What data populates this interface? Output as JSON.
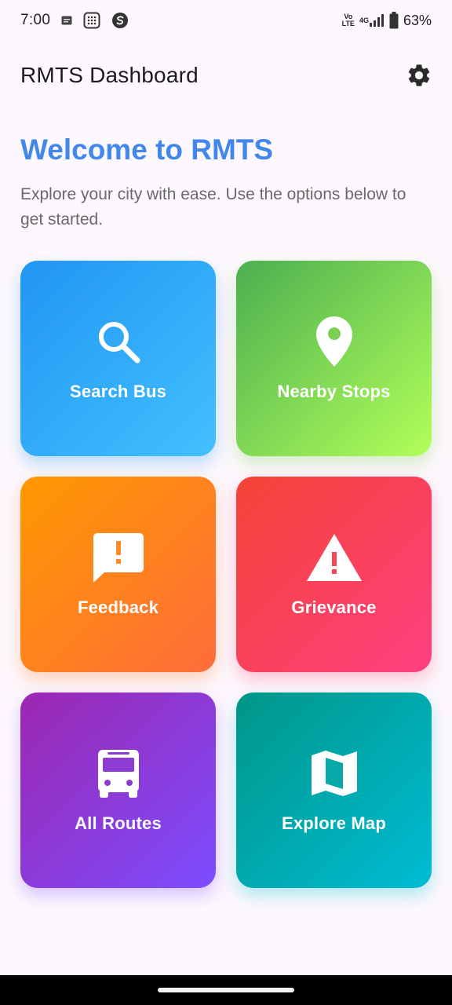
{
  "status_bar": {
    "time": "7:00",
    "volte_top": "Vo",
    "volte_bottom": "LTE",
    "network": "4G",
    "battery": "63%"
  },
  "app_bar": {
    "title": "RMTS Dashboard",
    "settings_icon": "gear-icon"
  },
  "welcome": {
    "title": "Welcome to RMTS",
    "subtitle": "Explore your city with ease. Use the options below to get started."
  },
  "cards": [
    {
      "label": "Search Bus",
      "icon": "search-icon",
      "colors": [
        "#2196f3",
        "#42c0fe"
      ]
    },
    {
      "label": "Nearby Stops",
      "icon": "location-pin-icon",
      "colors": [
        "#4caf50",
        "#b2ff59"
      ]
    },
    {
      "label": "Feedback",
      "icon": "feedback-icon",
      "colors": [
        "#ff9800",
        "#ff6d3a"
      ]
    },
    {
      "label": "Grievance",
      "icon": "warning-icon",
      "colors": [
        "#f44336",
        "#ff4081"
      ]
    },
    {
      "label": "All Routes",
      "icon": "bus-icon",
      "colors": [
        "#9c27b0",
        "#7c4dff"
      ]
    },
    {
      "label": "Explore Map",
      "icon": "map-icon",
      "colors": [
        "#009688",
        "#00bcd4"
      ]
    }
  ],
  "colors": {
    "accent": "#4287ec",
    "background": "#fdf8fd"
  }
}
